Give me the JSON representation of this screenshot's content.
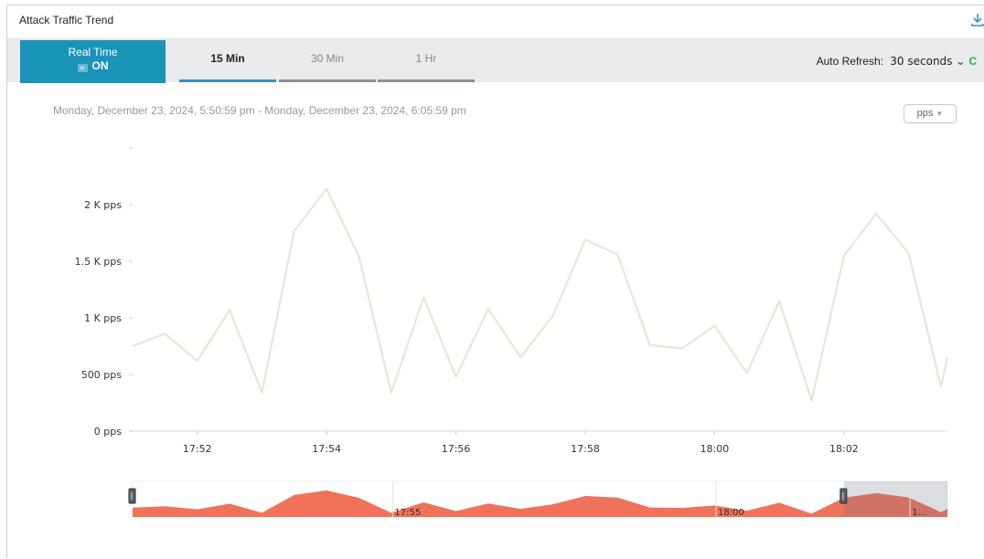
{
  "panel": {
    "title": "Attack Traffic Trend",
    "download_icon": "download-icon"
  },
  "toolbar": {
    "realtime_label": "Real Time",
    "realtime_state": "ON",
    "tabs": [
      {
        "label": "15 Min",
        "active": true
      },
      {
        "label": "30 Min",
        "active": false
      },
      {
        "label": "1 Hr",
        "active": false
      }
    ],
    "auto_refresh_label": "Auto Refresh:",
    "auto_refresh_value": "30 seconds",
    "accent_color": "#1a93b8"
  },
  "range_text": "Monday, December 23, 2024, 5:50:59 pm - Monday, December 23, 2024, 6:05:59 pm",
  "unit_select": "pps",
  "chart_data": {
    "type": "line",
    "xlabel": "",
    "ylabel": "",
    "y_ticks": [
      0,
      500,
      1000,
      1500,
      2000
    ],
    "y_tick_labels": [
      "0 pps",
      "500 pps",
      "1 K pps",
      "1.5 K pps",
      "2 K pps"
    ],
    "ylim": [
      0,
      2500
    ],
    "x_tick_labels": [
      "17:52",
      "17:54",
      "17:56",
      "17:58",
      "18:00",
      "18:02"
    ],
    "x_tick_minutes": [
      52,
      54,
      56,
      58,
      60,
      62
    ],
    "xlim_minutes": [
      51.0,
      63.6
    ],
    "grid": false,
    "line_color": "#e8e6d6",
    "series": [
      {
        "x_minutes": [
          51.0,
          51.5,
          52.0,
          52.5,
          53.0,
          53.5,
          54.0,
          54.5,
          55.0,
          55.5,
          56.0,
          56.5,
          57.0,
          57.5,
          58.0,
          58.5,
          59.0,
          59.5,
          60.0,
          60.5,
          61.0,
          61.5,
          62.0,
          62.5,
          63.0,
          63.5,
          63.6
        ],
        "values": [
          750,
          860,
          620,
          1070,
          340,
          1770,
          2140,
          1540,
          340,
          1180,
          480,
          1080,
          650,
          1020,
          1690,
          1560,
          760,
          730,
          930,
          510,
          1150,
          270,
          1550,
          1920,
          1570,
          390,
          650
        ]
      }
    ],
    "navigator": {
      "x_tick_labels": [
        "17:55",
        "18:00",
        "1..."
      ],
      "fill_color": "#f0725a",
      "selected_from_minutes": 62.0
    }
  }
}
